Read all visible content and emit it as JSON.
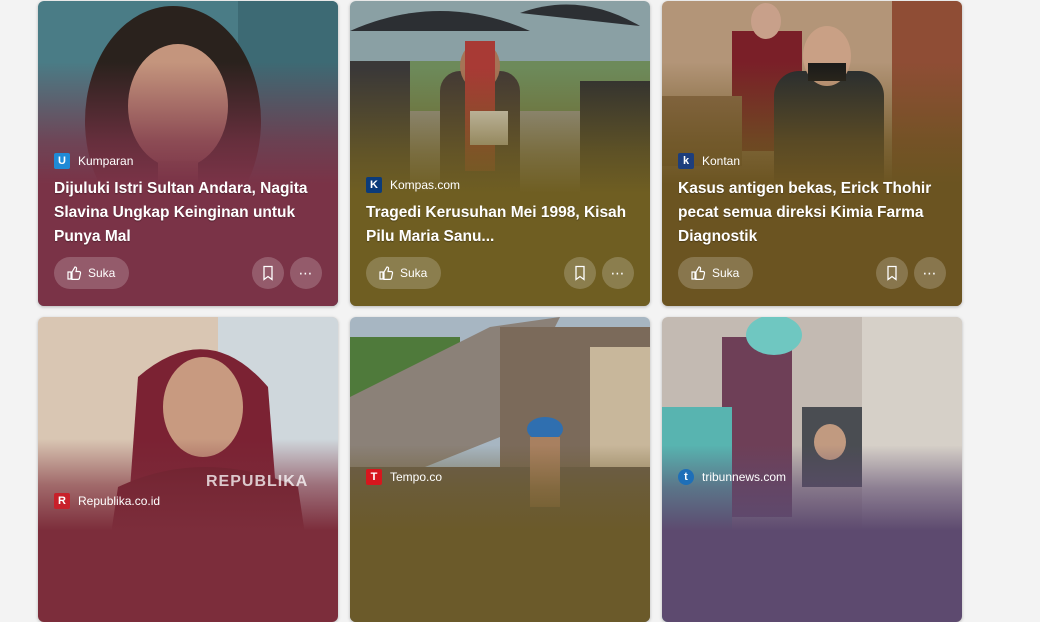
{
  "feed": {
    "like_label": "Suka",
    "cards": [
      {
        "source": "Kumparan",
        "title": "Dijuluki Istri Sultan Andara, Nagita Slavina Ungkap Keinginan untuk Punya Mal",
        "overlay_color": "#7a3347",
        "logo_color": "#1f8ad6",
        "logo_char": "U",
        "logo_icon": "kumparan-logo-icon"
      },
      {
        "source": "Kompas.com",
        "title": "Tragedi Kerusuhan Mei 1998, Kisah Pilu Maria Sanu...",
        "overlay_color": "#6f5e22",
        "logo_color": "#0b3b7a",
        "logo_char": "K",
        "logo_icon": "kompas-logo-icon"
      },
      {
        "source": "Kontan",
        "title": "Kasus antigen bekas, Erick Thohir pecat semua direksi Kimia Farma Diagnostik",
        "overlay_color": "#6b5421",
        "logo_color": "#1d3e7c",
        "logo_char": "k",
        "logo_icon": "kontan-logo-icon"
      },
      {
        "source": "Republika.co.id",
        "title": "",
        "overlay_color": "#7c2d3b",
        "logo_color": "#c8202a",
        "logo_char": "R",
        "logo_icon": "republika-logo-icon",
        "watermark": "REPUBLIKA"
      },
      {
        "source": "Tempo.co",
        "title": "",
        "overlay_color": "#6b5a2a",
        "logo_color": "#d7161d",
        "logo_char": "T",
        "logo_icon": "tempo-logo-icon"
      },
      {
        "source": "tribunnews.com",
        "title": "",
        "overlay_color": "#5d4a6f",
        "logo_color": "#1e6fb8",
        "logo_char": "t",
        "logo_icon": "tribunnews-logo-icon"
      }
    ]
  }
}
